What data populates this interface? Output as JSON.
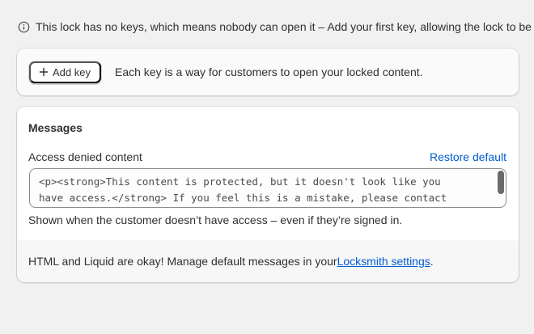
{
  "notice": {
    "icon": "info-icon",
    "text": "This lock has no keys, which means nobody can open it – Add your first key, allowing the lock to be"
  },
  "keys_card": {
    "add_key_icon": "plus-icon",
    "add_key_label": "Add key",
    "description": "Each key is a way for customers to open your locked content."
  },
  "messages": {
    "title": "Messages",
    "field_label": "Access denied content",
    "restore_label": "Restore default",
    "textarea_value": "<p><strong>This content is protected, but it doesn't look like you\nhave access.</strong> If you feel this is a mistake, please contact",
    "help_text": "Shown when the customer doesn’t have access – even if they’re signed in.",
    "footer_prefix": "HTML and Liquid are okay! Manage default messages in your ",
    "footer_link": "Locksmith settings",
    "footer_suffix": "."
  },
  "colors": {
    "link": "#005bd3",
    "text": "#303030",
    "background": "#f1f1f1"
  }
}
